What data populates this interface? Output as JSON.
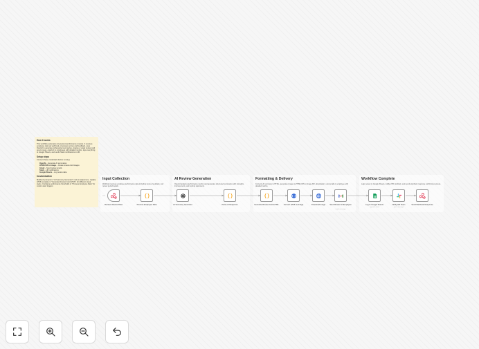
{
  "sticky": {
    "how_title": "How it works",
    "how_text": "This workflow automates AI-powered performance reviews. It receives employee data via webhook, processes scores and feedback, uses OpenAI to generate professional summaries, creates a visual review card as an image, emails it to employees with detailed metrics, logs everything to Google Sheets, and sends Slack notifications to HR.",
    "setup_title": "Setup steps",
    "setup_intro": "Connect these credentials before running:",
    "setup_items": [
      {
        "name": "OpenAI",
        "desc": "Generate AI summaries"
      },
      {
        "name": "HTMLCSS to Image",
        "desc": "Create review card images"
      },
      {
        "name": "Gmail",
        "desc": "Send review emails"
      },
      {
        "name": "Slack",
        "desc": "HR notifications"
      },
      {
        "name": "Google Sheets",
        "desc": "Log review data"
      }
    ],
    "custom_title": "Customization",
    "custom_text": "Modify AI prompts in \"AI Summary Generator\" node to adjust tone. Update HTML template in \"Generate Review Card HTML\" for different visual styles. Configure performance thresholds in \"Process Employee Data\" for custom alert triggers."
  },
  "sections": [
    {
      "title": "Input Collection",
      "desc": "Webhook receives employee performance data including scores, feedback, and review period details."
    },
    {
      "title": "AI Review Generation",
      "desc": "OpenAI analyzes performance metrics and generates structured summaries with strengths, improvements, and scoring statements."
    },
    {
      "title": "Formatting & Delivery",
      "desc": "Converts AI summary to HTML, generates image via HTMLCSS to Image API, downloads it, and emails to employee with detailed metrics."
    },
    {
      "title": "Workflow Complete",
      "desc": "Logs review to Google Sheets, notifies HR via Slack, and sends webhook response confirming success."
    }
  ],
  "nodes": [
    {
      "label": "Receive Review Data",
      "sub": "",
      "icon": "webhook-icon"
    },
    {
      "label": "Process Employee Data",
      "sub": "",
      "icon": "code-braces-icon"
    },
    {
      "label": "AI Summary Generator",
      "sub": "",
      "icon": "openai-icon"
    },
    {
      "label": "Parse AI Response",
      "sub": "",
      "icon": "code-braces-icon"
    },
    {
      "label": "Generate Review Card HTML",
      "sub": "",
      "icon": "code-braces-icon"
    },
    {
      "label": "Convert HTML to Image",
      "sub": "",
      "icon": "htmlcss-image-icon"
    },
    {
      "label": "Download Image",
      "sub": "",
      "icon": "globe-icon"
    },
    {
      "label": "Send Review to Employee",
      "sub": "send: message",
      "icon": "gmail-icon"
    },
    {
      "label": "Log to Google Sheets",
      "sub": "append: sheet",
      "icon": "google-sheets-icon"
    },
    {
      "label": "Notify HR Team",
      "sub": "post: message",
      "icon": "slack-icon"
    },
    {
      "label": "Send Webhook Response",
      "sub": "",
      "icon": "webhook-icon"
    }
  ],
  "controls": [
    {
      "name": "fit-view",
      "icon": "fit-view-icon"
    },
    {
      "name": "zoom-in",
      "icon": "zoom-in-icon"
    },
    {
      "name": "zoom-out",
      "icon": "zoom-out-icon"
    },
    {
      "name": "undo",
      "icon": "undo-icon"
    }
  ],
  "colors": {
    "webhook": "#e2445c",
    "code": "#f59e0b",
    "gmail_red": "#ea4335",
    "sheets_green": "#0f9d58",
    "globe_blue": "#3b6fd8",
    "sticky_bg": "#fbf3d6"
  }
}
